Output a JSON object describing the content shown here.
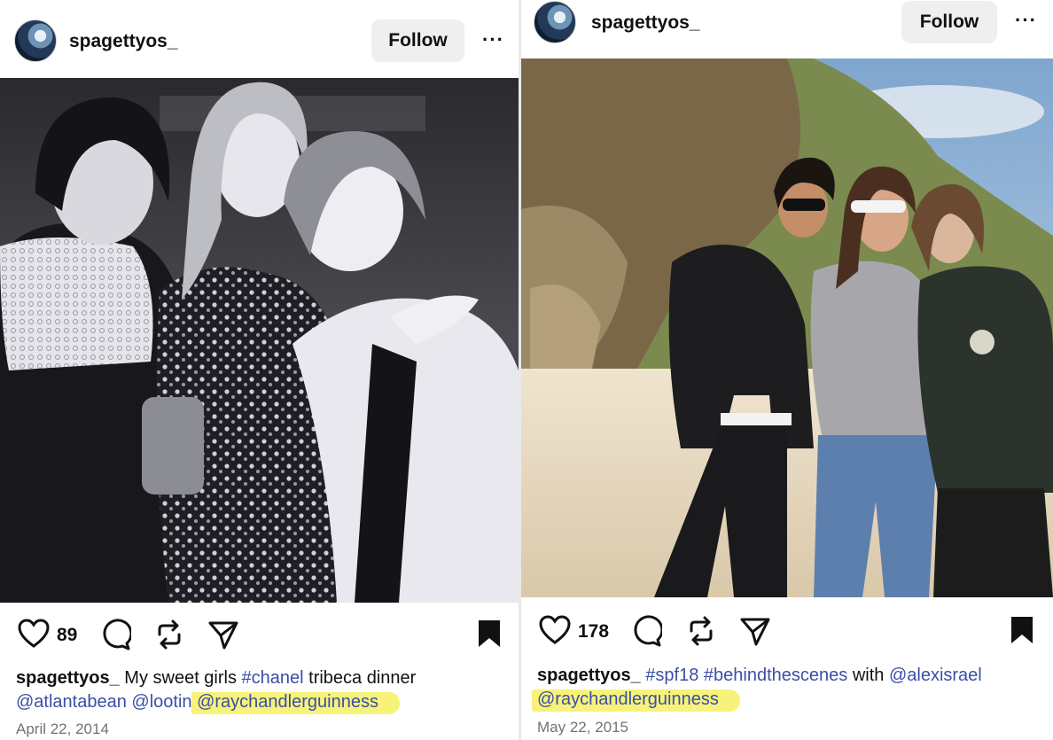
{
  "posts": [
    {
      "username": "spagettyos_",
      "follow_label": "Follow",
      "more_label": "···",
      "likes": "89",
      "caption": {
        "user": "spagettyos_",
        "text1": "My sweet girls ",
        "tag1": "#chanel",
        "text2": " tribeca dinner",
        "mention1": "@atlantabean",
        "mention2": "@lootin",
        "mention3_highlighted": "@raychandlerguinness"
      },
      "date": "April 22, 2014"
    },
    {
      "username": "spagettyos_",
      "follow_label": "Follow",
      "more_label": "···",
      "likes": "178",
      "caption": {
        "user": "spagettyos_",
        "tag1": "#spf18",
        "tag2": "#behindthescenes",
        "text1": " with ",
        "mention1": "@alexisrael",
        "mention2_highlighted": "@raychandlerguinness"
      },
      "date": "May 22, 2015"
    }
  ],
  "icons": [
    "heart-icon",
    "comment-icon",
    "repost-icon",
    "share-icon",
    "bookmark-icon"
  ],
  "colors": {
    "mention": "#3a4fa5",
    "highlight": "#f7f37a",
    "date": "#737373",
    "follow_bg": "#efefef"
  }
}
